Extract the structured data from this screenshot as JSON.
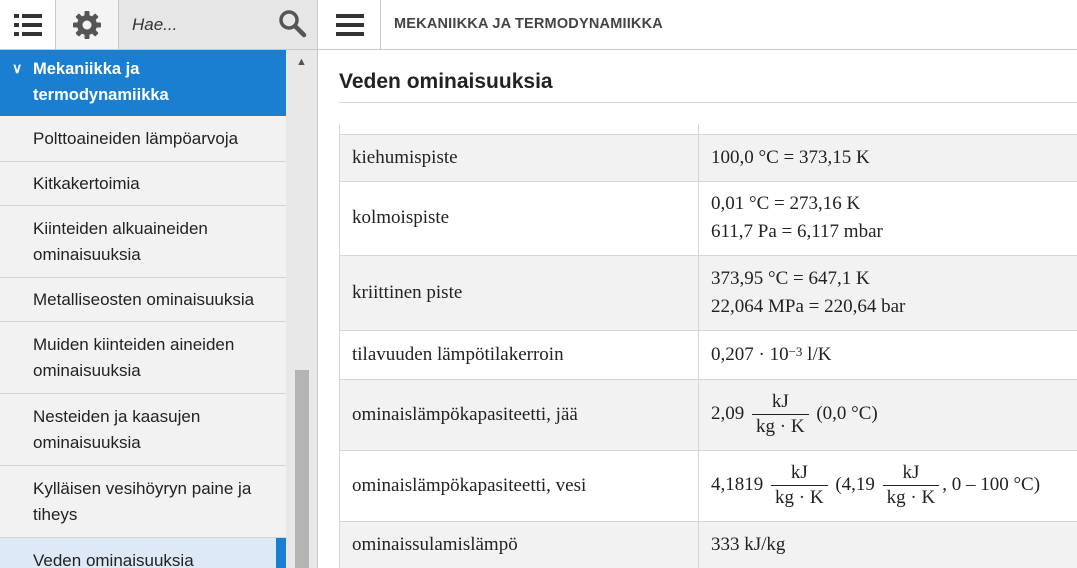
{
  "topbar": {
    "search_placeholder": "Hae...",
    "page_heading": "MEKANIIKKA JA TERMODYNAMIIKKA"
  },
  "sidebar": {
    "active_section": "Mekaniikka ja termodynamiikka",
    "items": [
      {
        "label": "Polttoaineiden lämpöarvoja"
      },
      {
        "label": "Kitkakertoimia"
      },
      {
        "label": "Kiinteiden alkuaineiden ominaisuuksia"
      },
      {
        "label": "Metalliseosten ominaisuuksia"
      },
      {
        "label": "Muiden kiinteiden aineiden ominaisuuksia"
      },
      {
        "label": "Nesteiden ja kaasujen ominaisuuksia"
      },
      {
        "label": "Kylläisen vesihöyryn paine ja tiheys"
      },
      {
        "label": "Veden ominaisuuksia"
      }
    ]
  },
  "main": {
    "title": "Veden ominaisuuksia",
    "rows": [
      {
        "property": "kiehumispiste",
        "value_line1": "100,0 °C = 373,15 K"
      },
      {
        "property": "kolmoispiste",
        "value_line1": "0,01 °C = 273,16 K",
        "value_line2": "611,7 Pa = 6,117 mbar"
      },
      {
        "property": "kriittinen piste",
        "value_line1": "373,95 °C = 647,1 K",
        "value_line2": "22,064 MPa = 220,64 bar"
      },
      {
        "property": "tilavuuden lämpötilakerroin",
        "value_mantissa": "0,207 · 10",
        "value_exponent": "−3",
        "value_unit": " l/K"
      },
      {
        "property": "ominaislämpökapasiteetti, jää",
        "value_number": "2,09",
        "frac_num": "kJ",
        "frac_den": "kg · K",
        "value_suffix": "(0,0 °C)"
      },
      {
        "property": "ominaislämpökapasiteetti, vesi",
        "value_number": "4,1819",
        "frac_num": "kJ",
        "frac_den": "kg · K",
        "value_middle": "(4,19",
        "frac2_num": "kJ",
        "frac2_den": "kg · K",
        "value_suffix": ", 0 – 100 °C)"
      },
      {
        "property": "ominaissulamislämpö",
        "value_line1": "333 kJ/kg"
      }
    ]
  }
}
